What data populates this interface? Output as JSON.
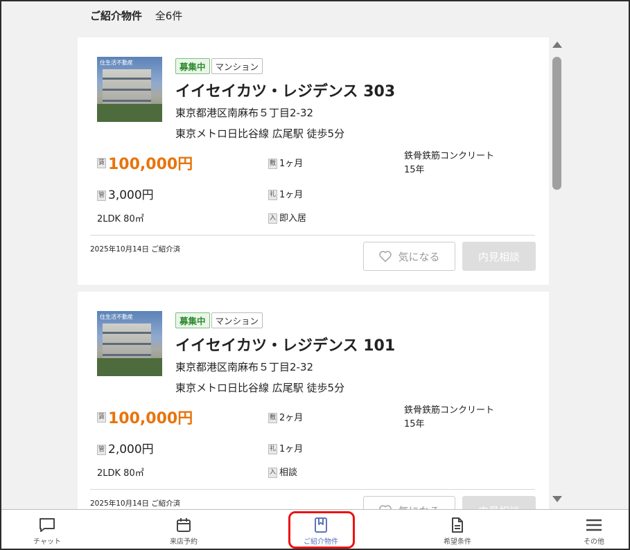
{
  "header": {
    "title": "ご紹介物件",
    "count": "全6件"
  },
  "cards": [
    {
      "thumb_watermark": "住生活不動産",
      "status": "募集中",
      "type": "マンション",
      "name": "イイセイカツ・レジデンス 303",
      "address": "東京都港区南麻布５丁目2-32",
      "station": "東京メトロ日比谷線 広尾駅 徒歩5分",
      "rent_icon": "賃",
      "rent": "100,000円",
      "fee_icon": "管",
      "fee": "3,000円",
      "layout": "2LDK 80㎡",
      "deposit_icon": "敷",
      "deposit": "1ヶ月",
      "key_icon": "礼",
      "key_money": "1ヶ月",
      "movein_icon": "入",
      "movein": "即入居",
      "structure": "鉄骨鉄筋コンクリート",
      "age": "15年",
      "date": "2025年10月14日 ご紹介済",
      "fav_label": "気になる",
      "view_label": "内見相談"
    },
    {
      "thumb_watermark": "住生活不動産",
      "status": "募集中",
      "type": "マンション",
      "name": "イイセイカツ・レジデンス 101",
      "address": "東京都港区南麻布５丁目2-32",
      "station": "東京メトロ日比谷線 広尾駅 徒歩5分",
      "rent_icon": "賃",
      "rent": "100,000円",
      "fee_icon": "管",
      "fee": "2,000円",
      "layout": "2LDK 80㎡",
      "deposit_icon": "敷",
      "deposit": "2ヶ月",
      "key_icon": "礼",
      "key_money": "1ヶ月",
      "movein_icon": "入",
      "movein": "相談",
      "structure": "鉄骨鉄筋コンクリート",
      "age": "15年",
      "date": "2025年10月14日 ご紹介済",
      "fav_label": "気になる",
      "view_label": "内見相談"
    }
  ],
  "nav": [
    {
      "label": "チャット",
      "icon": "chat-icon"
    },
    {
      "label": "来店予約",
      "icon": "calendar-icon"
    },
    {
      "label": "ご紹介物件",
      "icon": "bookmark-icon",
      "active": true
    },
    {
      "label": "希望条件",
      "icon": "document-icon"
    },
    {
      "label": "その他",
      "icon": "menu-icon"
    }
  ]
}
